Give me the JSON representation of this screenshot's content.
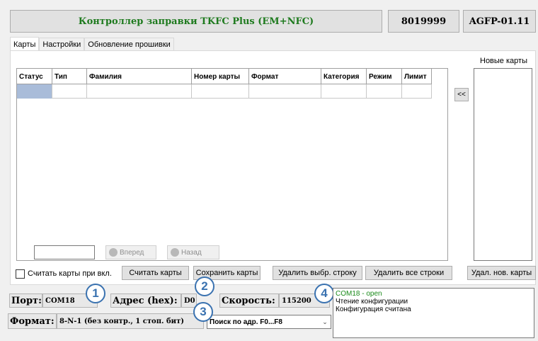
{
  "header": {
    "title": "Контроллер заправки TKFC Plus (EM+NFC)",
    "serial": "8019999",
    "firmware": "AGFP-01.11"
  },
  "tabs": [
    {
      "label": "Карты",
      "active": true
    },
    {
      "label": "Настройки",
      "active": false
    },
    {
      "label": "Обновление прошивки",
      "active": false
    }
  ],
  "new_cards": {
    "label": "Новые карты",
    "move_button": "<<"
  },
  "table": {
    "columns": [
      "Статус",
      "Тип",
      "Фамилия",
      "Номер карты",
      "Формат",
      "Категория",
      "Режим",
      "Лимит"
    ]
  },
  "navigation": {
    "forward": "Вперед",
    "back": "Назад"
  },
  "actions": {
    "read_on_start": "Считать карты при вкл.",
    "read_cards": "Считать карты",
    "save_cards": "Сохранить карты",
    "delete_selected": "Удалить выбр. строку",
    "delete_all": "Удалить все строки",
    "delete_new": "Удал. нов. карты"
  },
  "connection": {
    "port_label": "Порт:",
    "port_value": "COM18",
    "address_label": "Адрес (hex):",
    "address_value": "D0",
    "speed_label": "Скорость:",
    "speed_value": "115200",
    "format_label": "Формат:",
    "format_value": "8-N-1 (без контр., 1 стоп. бит)",
    "search_option": "Поиск по адр. F0...F8"
  },
  "badges": [
    "1",
    "2",
    "3",
    "4"
  ],
  "log": [
    {
      "text": "COM18 - open",
      "color": "#1a8a1a"
    },
    {
      "text": "Чтение конфигурации",
      "color": "#000000"
    },
    {
      "text": "Конфигурация считана",
      "color": "#000000"
    }
  ],
  "colors": {
    "title_text": "#1e7a1e",
    "badge": "#3a72b0",
    "selected_cell": "#a9bcd9"
  }
}
